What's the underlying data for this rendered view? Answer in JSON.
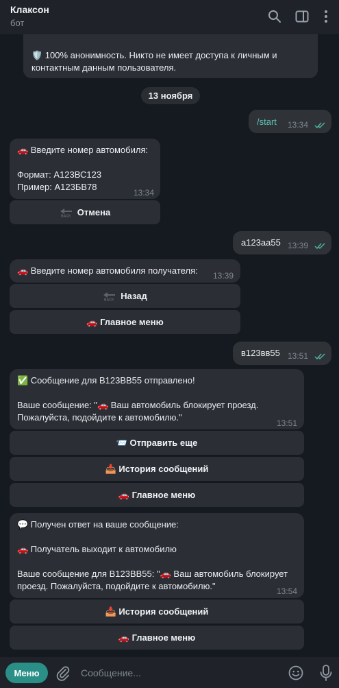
{
  "header": {
    "title": "Клаксон",
    "subtitle": "бот"
  },
  "messages": {
    "intro_partial": "🛡️ 100% анонимность. Никто не имеет доступа к личным и контактным данным пользователя.",
    "date_separator": "13 ноября",
    "out1": {
      "text": "/start",
      "time": "13:34"
    },
    "in1": {
      "text": "🚗 Введите номер автомобиля:\n\nФормат: А123ВС123\nПример: А123БВ78",
      "time": "13:34"
    },
    "in1_btn_cancel": "Отмена",
    "out2": {
      "text": "а123аа55",
      "time": "13:39"
    },
    "in2": {
      "text": "🚗 Введите номер автомобиля получателя:",
      "time": "13:39"
    },
    "in2_btn_back": "Назад",
    "in2_btn_main": "🚗 Главное меню",
    "out3": {
      "text": "в123вв55",
      "time": "13:51"
    },
    "in3": {
      "text": "✅ Сообщение для В123ВВ55 отправлено!\n\nВаше сообщение: \"🚗 Ваш автомобиль блокирует проезд. Пожалуйста, подойдите к автомобилю.\"",
      "time": "13:51"
    },
    "in3_btn_send_more": "📨 Отправить еще",
    "in3_btn_history": "📥 История сообщений",
    "in3_btn_main": "🚗 Главное меню",
    "in4": {
      "text": "💬 Получен ответ на ваше сообщение:\n\n🚗 Получатель выходит к автомобилю\n\nВаше сообщение для В123ВВ55: \"🚗 Ваш автомобиль блокирует проезд. Пожалуйста, подойдите к автомобилю.\"",
      "time": "13:54"
    },
    "in4_btn_history": "📥 История сообщений",
    "in4_btn_main": "🚗 Главное меню"
  },
  "composer": {
    "menu_label": "Меню",
    "placeholder": "Сообщение..."
  },
  "colors": {
    "accent": "#2a8f86",
    "read_check": "#4fae9f"
  },
  "icons": [
    "search-icon",
    "sidebar-toggle-icon",
    "more-vert-icon",
    "attach-icon",
    "emoji-icon",
    "microphone-icon",
    "back-arrow-icon"
  ]
}
